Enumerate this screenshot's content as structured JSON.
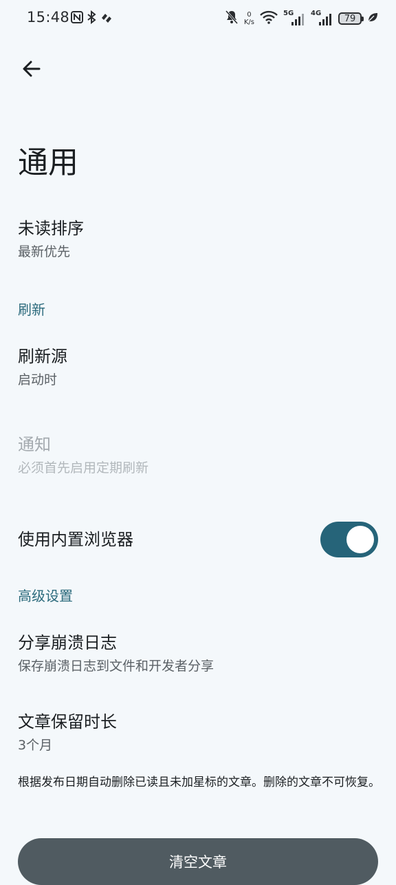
{
  "status_bar": {
    "time": "15:48",
    "speed_value": "0",
    "speed_unit": "K/s",
    "net1": "5G",
    "net2": "4G",
    "battery": "79"
  },
  "header": {
    "title": "通用"
  },
  "settings": {
    "unread_sort": {
      "title": "未读排序",
      "value": "最新优先"
    },
    "section_refresh": "刷新",
    "refresh_source": {
      "title": "刷新源",
      "value": "启动时"
    },
    "notification": {
      "title": "通知",
      "value": "必须首先启用定期刷新"
    },
    "builtin_browser": {
      "title": "使用内置浏览器",
      "enabled": true
    },
    "section_advanced": "高级设置",
    "share_crash_log": {
      "title": "分享崩溃日志",
      "value": "保存崩溃日志到文件和开发者分享"
    },
    "article_retention": {
      "title": "文章保留时长",
      "value": "3个月"
    },
    "retention_note": "根据发布日期自动删除已读且未加星标的文章。删除的文章不可恢复。",
    "clear_button": "清空文章"
  },
  "colors": {
    "background": "#f4f8fb",
    "accent": "#266479",
    "section_header": "#2b6a7c",
    "button": "#505b61"
  }
}
